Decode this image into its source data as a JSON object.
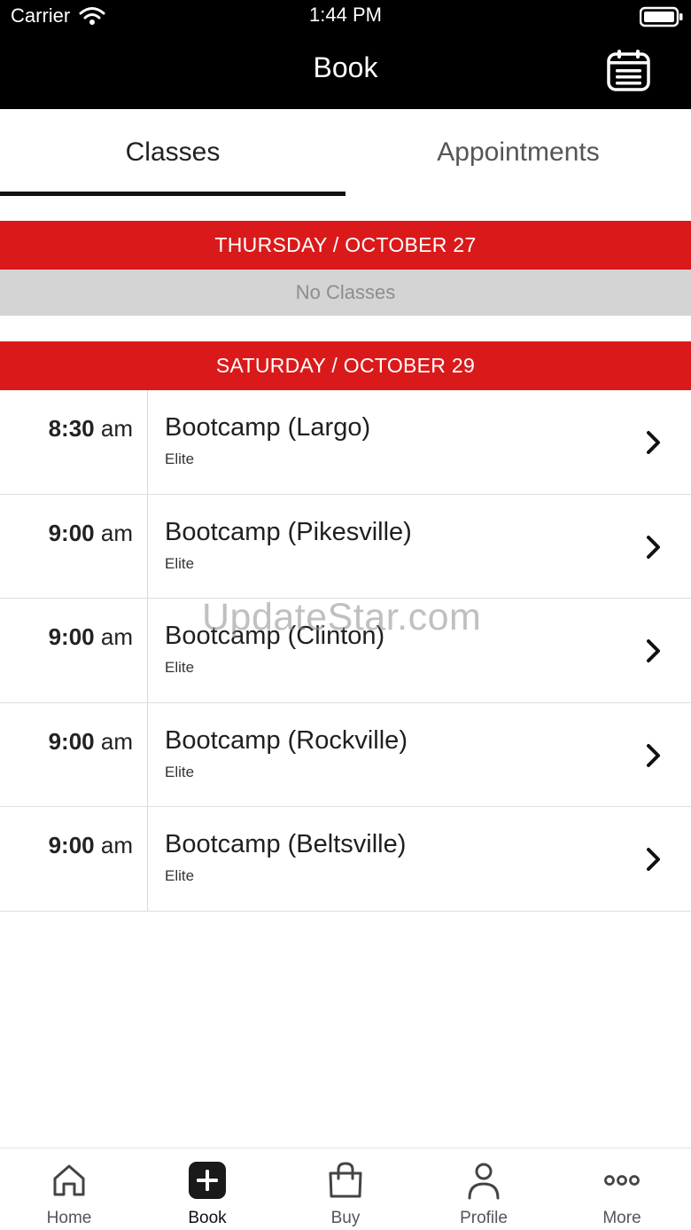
{
  "status_bar": {
    "carrier": "Carrier",
    "time": "1:44 PM"
  },
  "nav": {
    "title": "Book",
    "right_icon": "calendar-icon"
  },
  "tabs": [
    {
      "label": "Classes",
      "active": true
    },
    {
      "label": "Appointments",
      "active": false
    }
  ],
  "days": [
    {
      "header": "THURSDAY / OCTOBER 27",
      "empty_text": "No Classes"
    },
    {
      "header": "SATURDAY / OCTOBER 29"
    }
  ],
  "classes": [
    {
      "time_num": "8:30",
      "time_ampm": "am",
      "name": "Bootcamp (Largo)",
      "level": "Elite"
    },
    {
      "time_num": "9:00",
      "time_ampm": "am",
      "name": "Bootcamp (Pikesville)",
      "level": "Elite"
    },
    {
      "time_num": "9:00",
      "time_ampm": "am",
      "name": "Bootcamp (Clinton)",
      "level": "Elite"
    },
    {
      "time_num": "9:00",
      "time_ampm": "am",
      "name": "Bootcamp (Rockville)",
      "level": "Elite"
    },
    {
      "time_num": "9:00",
      "time_ampm": "am",
      "name": "Bootcamp (Beltsville)",
      "level": "Elite"
    }
  ],
  "watermark": "UpdateStar.com",
  "tabbar": [
    {
      "label": "Home",
      "icon": "home-icon",
      "active": false
    },
    {
      "label": "Book",
      "icon": "plus-square-icon",
      "active": true
    },
    {
      "label": "Buy",
      "icon": "shopping-bag-icon",
      "active": false
    },
    {
      "label": "Profile",
      "icon": "person-icon",
      "active": false
    },
    {
      "label": "More",
      "icon": "more-dots-icon",
      "active": false
    }
  ],
  "colors": {
    "accent_red": "#da1a1a",
    "nav_background": "#000000",
    "empty_row_gray": "#d4d4d4"
  }
}
